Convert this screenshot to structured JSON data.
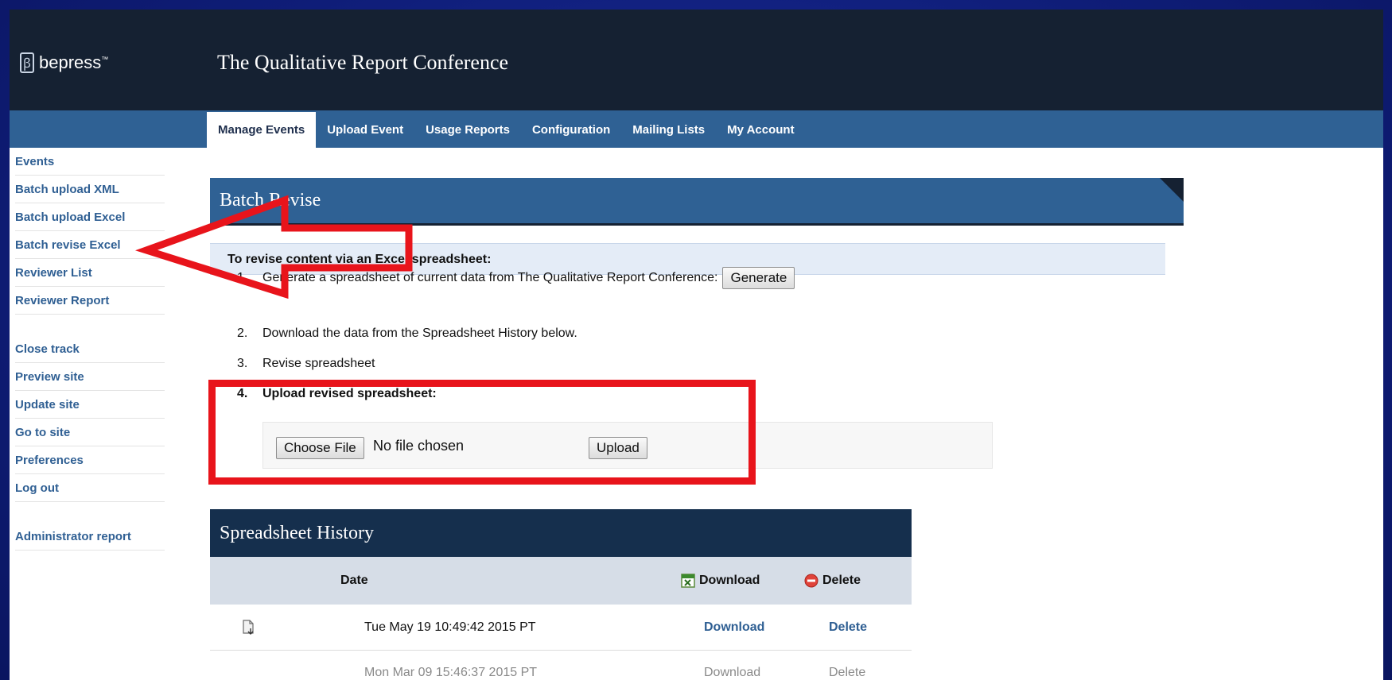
{
  "header": {
    "logo_text": "bepress",
    "logo_mark": "ꞵ",
    "logo_tm": "™",
    "site_title": "The Qualitative Report Conference"
  },
  "nav": {
    "tabs": [
      {
        "label": "Manage Events",
        "active": true
      },
      {
        "label": "Upload Event"
      },
      {
        "label": "Usage Reports"
      },
      {
        "label": "Configuration"
      },
      {
        "label": "Mailing Lists"
      },
      {
        "label": "My Account"
      }
    ]
  },
  "sidebar": {
    "group1": [
      "Events",
      "Batch upload XML",
      "Batch upload Excel",
      "Batch revise Excel",
      "Reviewer List",
      "Reviewer Report"
    ],
    "group2": [
      "Close track",
      "Preview site",
      "Update site",
      "Go to site",
      "Preferences",
      "Log out"
    ],
    "group3": [
      "Administrator report"
    ]
  },
  "batch": {
    "title": "Batch Revise",
    "instructions": "To revise content via an Excel spreadsheet:",
    "steps": [
      {
        "num": "1.",
        "text": "Generate a spreadsheet of current data from The Qualitative Report Conference:",
        "button": "Generate"
      },
      {
        "num": "2.",
        "text": "Download the data from the Spreadsheet History below."
      },
      {
        "num": "3.",
        "text": "Revise spreadsheet"
      },
      {
        "num": "4.",
        "text": "Upload revised spreadsheet:"
      }
    ],
    "choose_file": "Choose File",
    "file_status": "No file chosen",
    "upload": "Upload"
  },
  "history": {
    "title": "Spreadsheet History",
    "col_date": "Date",
    "col_download": "Download",
    "col_delete": "Delete",
    "rows": [
      {
        "date": "Tue May 19 10:49:42 2015 PT",
        "download": "Download",
        "delete": "Delete"
      },
      {
        "date": "Mon Mar 09 15:46:37 2015 PT",
        "download": "Download",
        "delete": "Delete"
      }
    ]
  },
  "colors": {
    "accent": "#2f6194",
    "header": "#152132",
    "annotation_red": "#e8141b",
    "link": "#2f5f93"
  }
}
